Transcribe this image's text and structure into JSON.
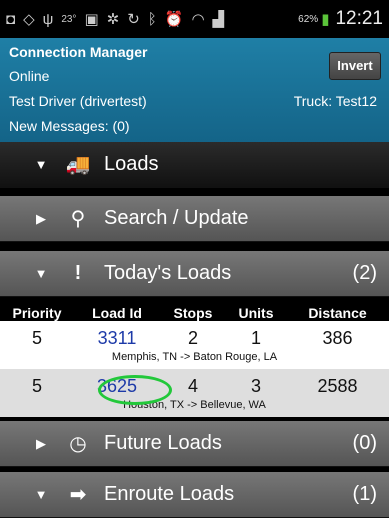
{
  "statusbar": {
    "temp": "23°",
    "battery": "62%",
    "time": "12:21",
    "icons": [
      "notification-icon",
      "location-icon",
      "usb-icon",
      "gallery-icon",
      "settings-icon",
      "sync-icon",
      "bluetooth-icon",
      "alarm-icon",
      "wifi-icon",
      "signal-icon",
      "battery-icon"
    ]
  },
  "header": {
    "title": "Connection Manager",
    "status": "Online",
    "driver": "Test Driver (drivertest)",
    "truck": "Truck: Test12",
    "messages": "New Messages: (0)",
    "invert_label": "Invert",
    "colors": {
      "bg": "#1a74a0"
    }
  },
  "sections": {
    "loads": {
      "label": "Loads",
      "icon": "truck-icon",
      "expanded": true
    },
    "search": {
      "label": "Search / Update",
      "icon": "search-icon",
      "expanded": false
    },
    "today": {
      "label": "Today's Loads",
      "icon": "exclamation-icon",
      "count": "(2)",
      "expanded": true
    },
    "future": {
      "label": "Future Loads",
      "icon": "clock-icon",
      "count": "(0)",
      "expanded": false
    },
    "enroute": {
      "label": "Enroute Loads",
      "icon": "arrow-right-icon",
      "count": "(1)",
      "expanded": true
    }
  },
  "table": {
    "headers": [
      "Priority",
      "Load Id",
      "Stops",
      "Units",
      "Distance"
    ],
    "rows": [
      {
        "priority": "5",
        "load_id": "3311",
        "stops": "2",
        "units": "1",
        "distance": "386",
        "route": "Memphis, TN -> Baton Rouge, LA"
      },
      {
        "priority": "5",
        "load_id": "3625",
        "stops": "4",
        "units": "3",
        "distance": "2588",
        "route": "Houston, TX -> Bellevue, WA"
      }
    ]
  }
}
